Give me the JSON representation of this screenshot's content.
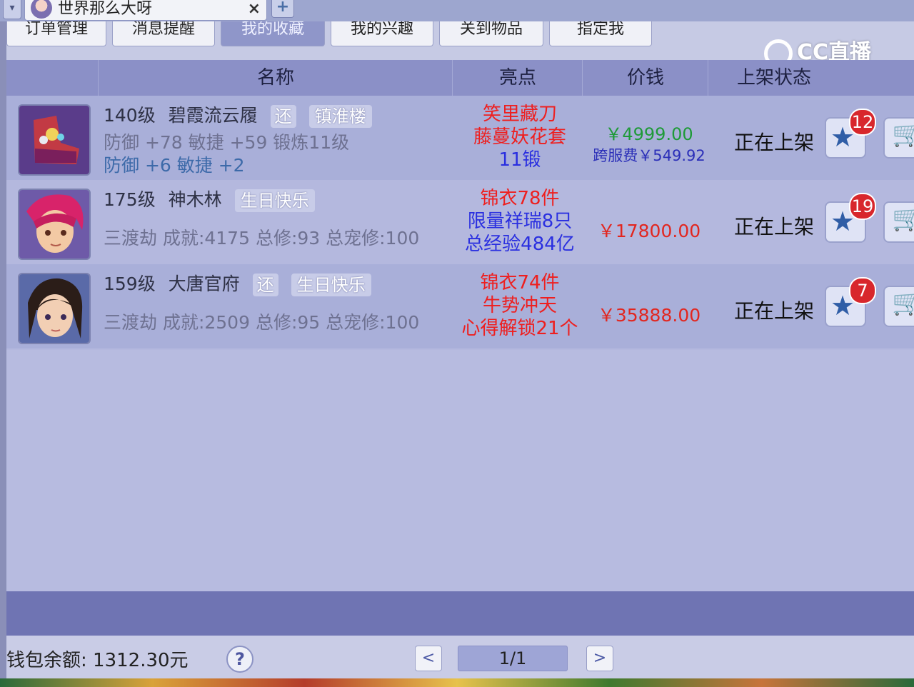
{
  "window": {
    "tab_title": "世界那么大呀",
    "close_glyph": "×",
    "new_tab_glyph": "+",
    "tab_menu_glyph": "▾"
  },
  "nav": {
    "items": [
      {
        "label": "订单管理",
        "active": false
      },
      {
        "label": "消息提醒",
        "active": false
      },
      {
        "label": "我的收藏",
        "active": true
      },
      {
        "label": "我的兴趣",
        "active": false
      },
      {
        "label": "关到物品",
        "active": false
      },
      {
        "label": "指定我",
        "active": false
      }
    ]
  },
  "watermark": {
    "text": "CC直播"
  },
  "table": {
    "headers": [
      "名称",
      "亮点",
      "价钱",
      "上架状态"
    ],
    "rows": [
      {
        "level": "140级",
        "name": "碧霞流云履",
        "tags": [
          "还",
          "镇淮楼"
        ],
        "stats_line1": "防御 +78 敏捷 +59 锻炼11级",
        "stats_line2": "防御 +6 敏捷 +2",
        "highlights": [
          {
            "text": "笑里藏刀",
            "color": "red"
          },
          {
            "text": "藤蔓妖花套",
            "color": "red"
          },
          {
            "text": "11锻",
            "color": "blue"
          }
        ],
        "price": "￥4999.00",
        "fee": "跨服费￥549.92",
        "status": "正在上架",
        "fav_count": "12",
        "icon": "boots-icon"
      },
      {
        "level": "175级",
        "name": "神木林",
        "tags": [
          "生日快乐"
        ],
        "stats_line1": "三渡劫 成就:4175 总修:93 总宠修:100",
        "stats_line2": "",
        "highlights": [
          {
            "text": "锦衣78件",
            "color": "red"
          },
          {
            "text": "限量祥瑞8只",
            "color": "blue"
          },
          {
            "text": "总经验484亿",
            "color": "blue"
          }
        ],
        "price": "￥17800.00",
        "fee": "",
        "status": "正在上架",
        "fav_count": "19",
        "icon": "character-avatar-icon"
      },
      {
        "level": "159级",
        "name": "大唐官府",
        "tags": [
          "还",
          "生日快乐"
        ],
        "stats_line1": "三渡劫 成就:2509 总修:95 总宠修:100",
        "stats_line2": "",
        "highlights": [
          {
            "text": "锦衣74件",
            "color": "red"
          },
          {
            "text": "牛势冲天",
            "color": "red"
          },
          {
            "text": "心得解锁21个",
            "color": "red"
          }
        ],
        "price": "￥35888.00",
        "fee": "",
        "status": "正在上架",
        "fav_count": "7",
        "icon": "character-avatar-icon"
      }
    ]
  },
  "footer": {
    "balance": "钱包余额: 1312.30元",
    "help": "?",
    "prev": "<",
    "page": "1/1",
    "next": ">"
  },
  "colors": {
    "red": "#ee1f1f",
    "blue": "#2a2fe0",
    "price_green": "#1e9a38",
    "price_red": "#e2261f"
  }
}
